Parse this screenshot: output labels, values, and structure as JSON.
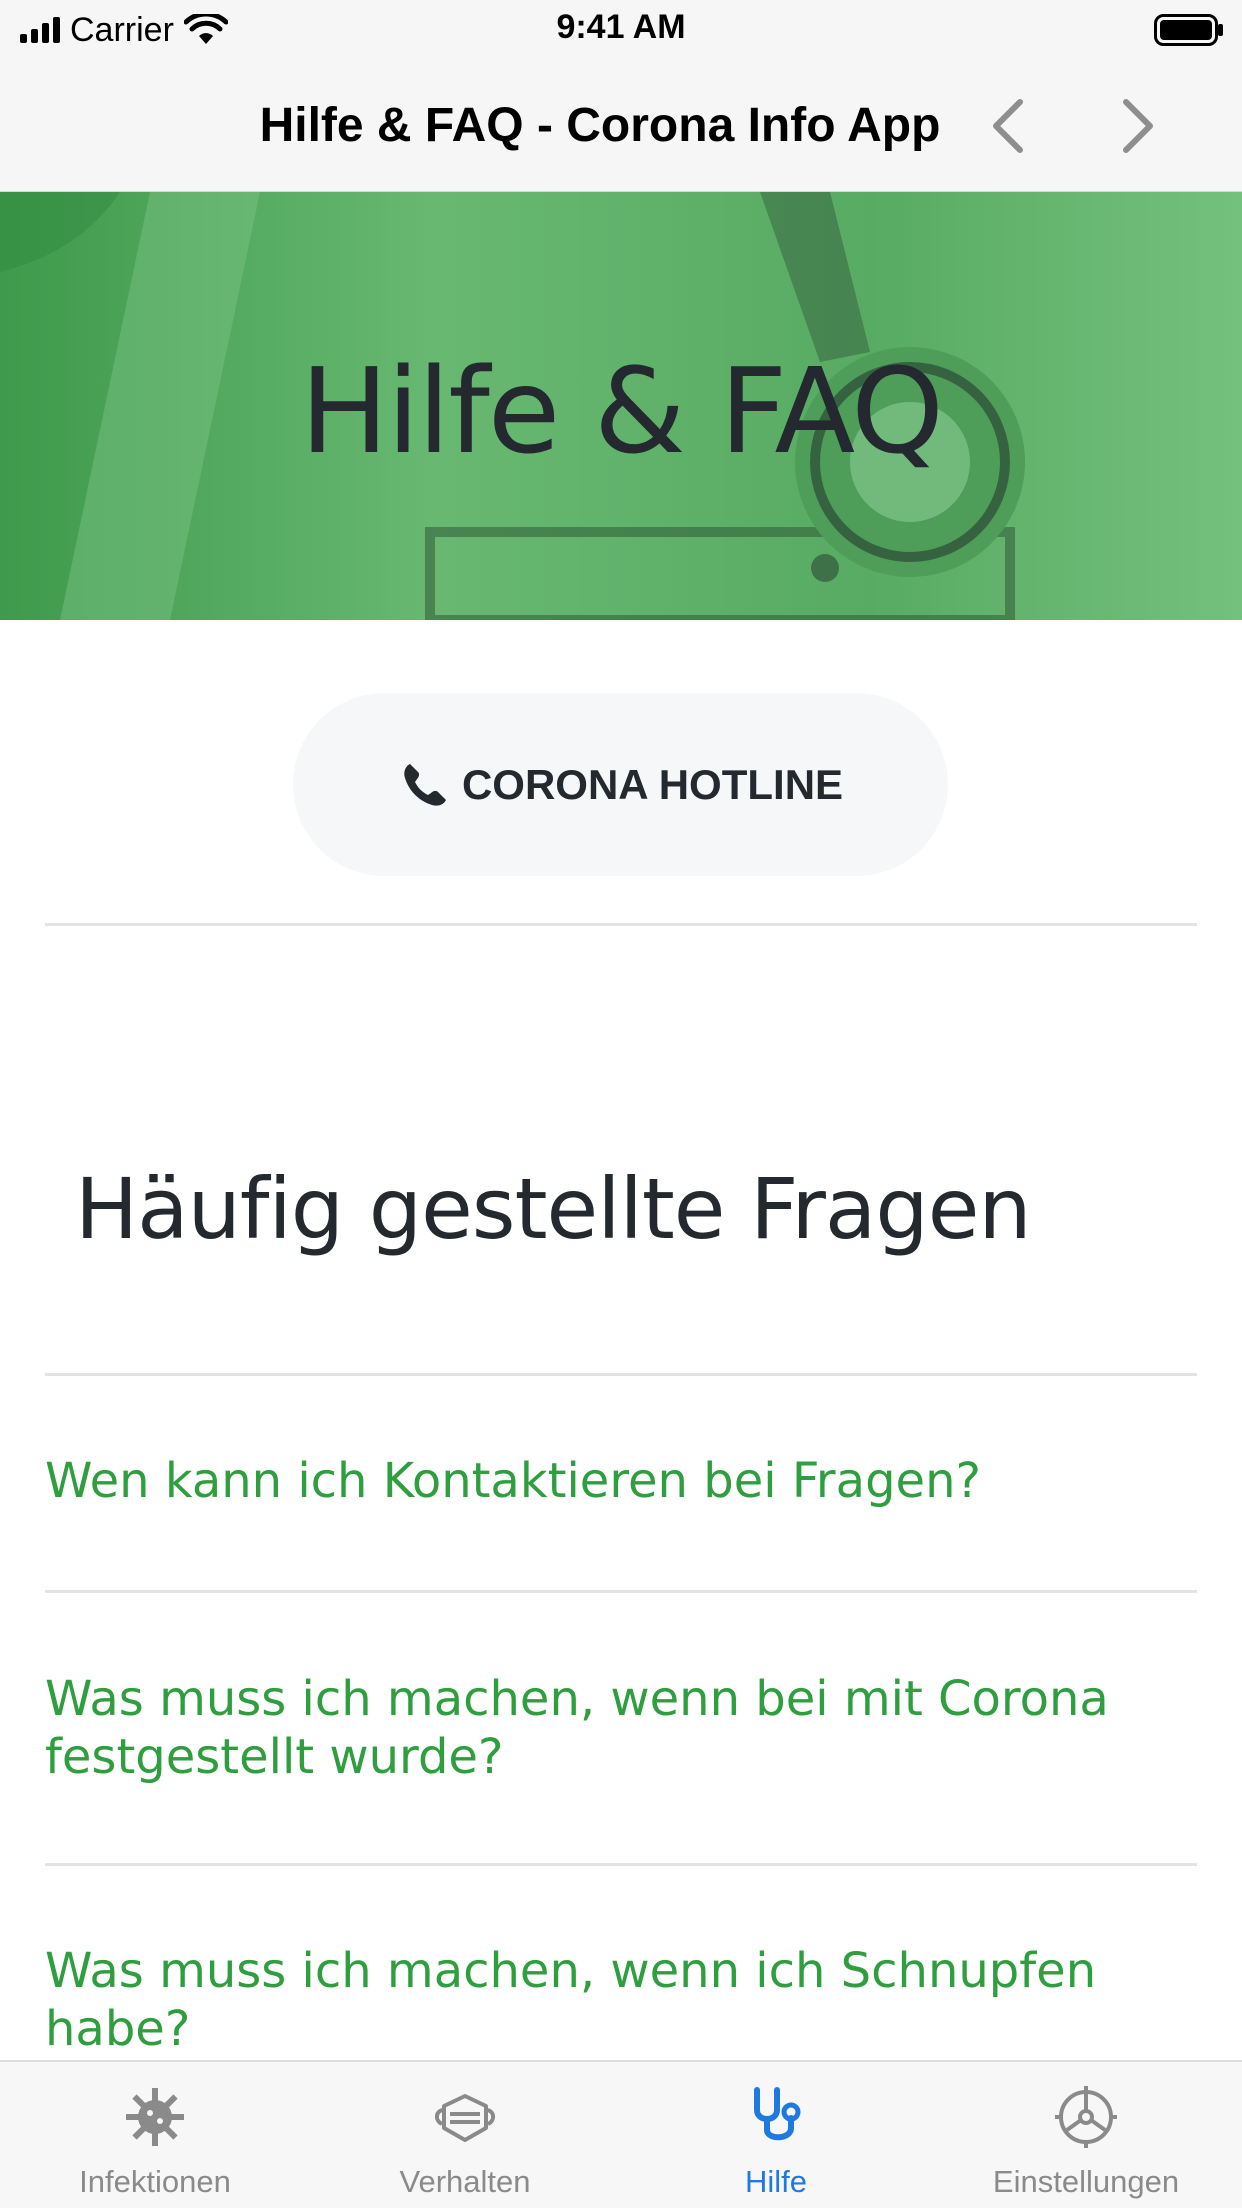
{
  "status_bar": {
    "carrier": "Carrier",
    "time": "9:41 AM"
  },
  "nav_bar": {
    "title": "Hilfe & FAQ - Corona Info App",
    "back_icon": "chevron-left-icon",
    "forward_icon": "chevron-right-icon"
  },
  "hero": {
    "title": "Hilfe & FAQ"
  },
  "hotline": {
    "icon": "phone-icon",
    "label": "CORONA HOTLINE"
  },
  "faq": {
    "heading": "Häufig gestellte Fragen",
    "items": [
      {
        "question": "Wen kann ich Kontaktieren bei Fragen?"
      },
      {
        "question": "Was muss ich machen, wenn bei mit Corona festgestellt wurde?"
      },
      {
        "question": "Was muss ich machen, wenn ich Schnupfen habe?"
      }
    ]
  },
  "tab_bar": {
    "items": [
      {
        "label": "Infektionen",
        "icon": "virus-icon",
        "active": false
      },
      {
        "label": "Verhalten",
        "icon": "face-mask-icon",
        "active": false
      },
      {
        "label": "Hilfe",
        "icon": "stethoscope-icon",
        "active": true
      },
      {
        "label": "Einstellungen",
        "icon": "settings-wheel-icon",
        "active": false
      }
    ]
  },
  "colors": {
    "accent_green": "#2e9e3e",
    "hero_green": "#5aaf64",
    "active_tab": "#1f7ae0",
    "inactive_tab": "#8a8a8a"
  }
}
